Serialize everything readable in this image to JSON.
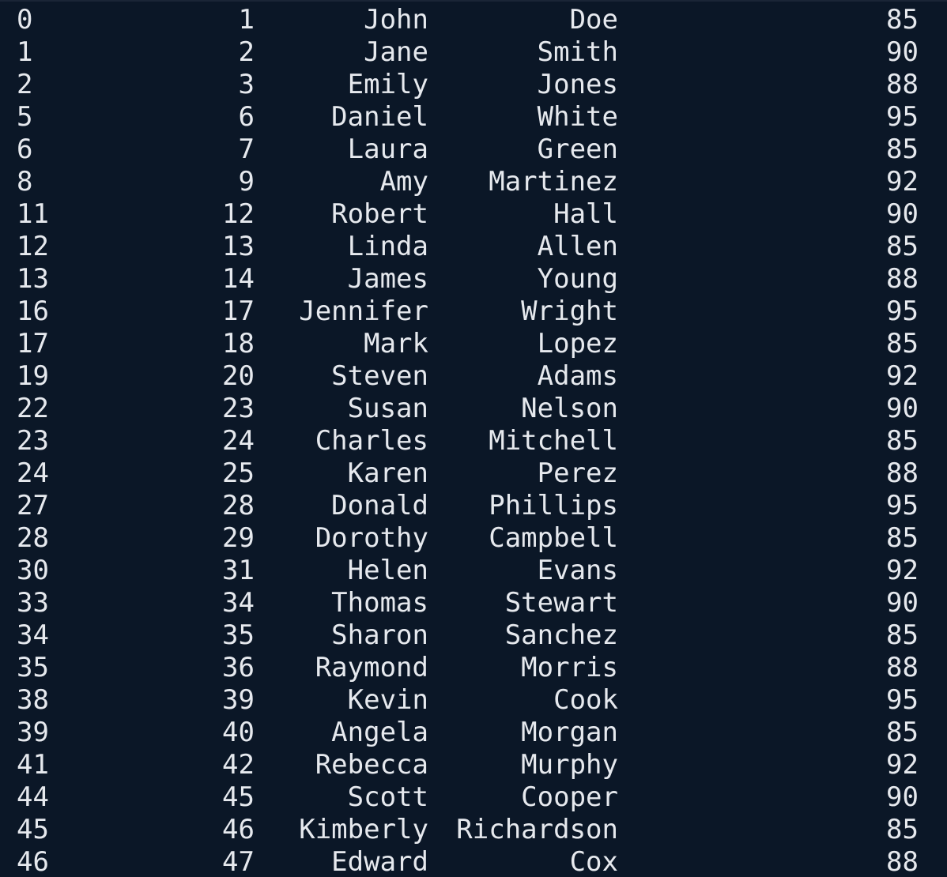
{
  "terminal": {
    "rows": [
      {
        "index": "0",
        "id": "1",
        "first_name": "John",
        "last_name": "Doe",
        "score": "85"
      },
      {
        "index": "1",
        "id": "2",
        "first_name": "Jane",
        "last_name": "Smith",
        "score": "90"
      },
      {
        "index": "2",
        "id": "3",
        "first_name": "Emily",
        "last_name": "Jones",
        "score": "88"
      },
      {
        "index": "5",
        "id": "6",
        "first_name": "Daniel",
        "last_name": "White",
        "score": "95"
      },
      {
        "index": "6",
        "id": "7",
        "first_name": "Laura",
        "last_name": "Green",
        "score": "85"
      },
      {
        "index": "8",
        "id": "9",
        "first_name": "Amy",
        "last_name": "Martinez",
        "score": "92"
      },
      {
        "index": "11",
        "id": "12",
        "first_name": "Robert",
        "last_name": "Hall",
        "score": "90"
      },
      {
        "index": "12",
        "id": "13",
        "first_name": "Linda",
        "last_name": "Allen",
        "score": "85"
      },
      {
        "index": "13",
        "id": "14",
        "first_name": "James",
        "last_name": "Young",
        "score": "88"
      },
      {
        "index": "16",
        "id": "17",
        "first_name": "Jennifer",
        "last_name": "Wright",
        "score": "95"
      },
      {
        "index": "17",
        "id": "18",
        "first_name": "Mark",
        "last_name": "Lopez",
        "score": "85"
      },
      {
        "index": "19",
        "id": "20",
        "first_name": "Steven",
        "last_name": "Adams",
        "score": "92"
      },
      {
        "index": "22",
        "id": "23",
        "first_name": "Susan",
        "last_name": "Nelson",
        "score": "90"
      },
      {
        "index": "23",
        "id": "24",
        "first_name": "Charles",
        "last_name": "Mitchell",
        "score": "85"
      },
      {
        "index": "24",
        "id": "25",
        "first_name": "Karen",
        "last_name": "Perez",
        "score": "88"
      },
      {
        "index": "27",
        "id": "28",
        "first_name": "Donald",
        "last_name": "Phillips",
        "score": "95"
      },
      {
        "index": "28",
        "id": "29",
        "first_name": "Dorothy",
        "last_name": "Campbell",
        "score": "85"
      },
      {
        "index": "30",
        "id": "31",
        "first_name": "Helen",
        "last_name": "Evans",
        "score": "92"
      },
      {
        "index": "33",
        "id": "34",
        "first_name": "Thomas",
        "last_name": "Stewart",
        "score": "90"
      },
      {
        "index": "34",
        "id": "35",
        "first_name": "Sharon",
        "last_name": "Sanchez",
        "score": "85"
      },
      {
        "index": "35",
        "id": "36",
        "first_name": "Raymond",
        "last_name": "Morris",
        "score": "88"
      },
      {
        "index": "38",
        "id": "39",
        "first_name": "Kevin",
        "last_name": "Cook",
        "score": "95"
      },
      {
        "index": "39",
        "id": "40",
        "first_name": "Angela",
        "last_name": "Morgan",
        "score": "85"
      },
      {
        "index": "41",
        "id": "42",
        "first_name": "Rebecca",
        "last_name": "Murphy",
        "score": "92"
      },
      {
        "index": "44",
        "id": "45",
        "first_name": "Scott",
        "last_name": "Cooper",
        "score": "90"
      },
      {
        "index": "45",
        "id": "46",
        "first_name": "Kimberly",
        "last_name": "Richardson",
        "score": "85"
      },
      {
        "index": "46",
        "id": "47",
        "first_name": "Edward",
        "last_name": "Cox",
        "score": "88"
      }
    ]
  },
  "colors": {
    "background": "#0b1727",
    "text": "#e6e9ee"
  }
}
